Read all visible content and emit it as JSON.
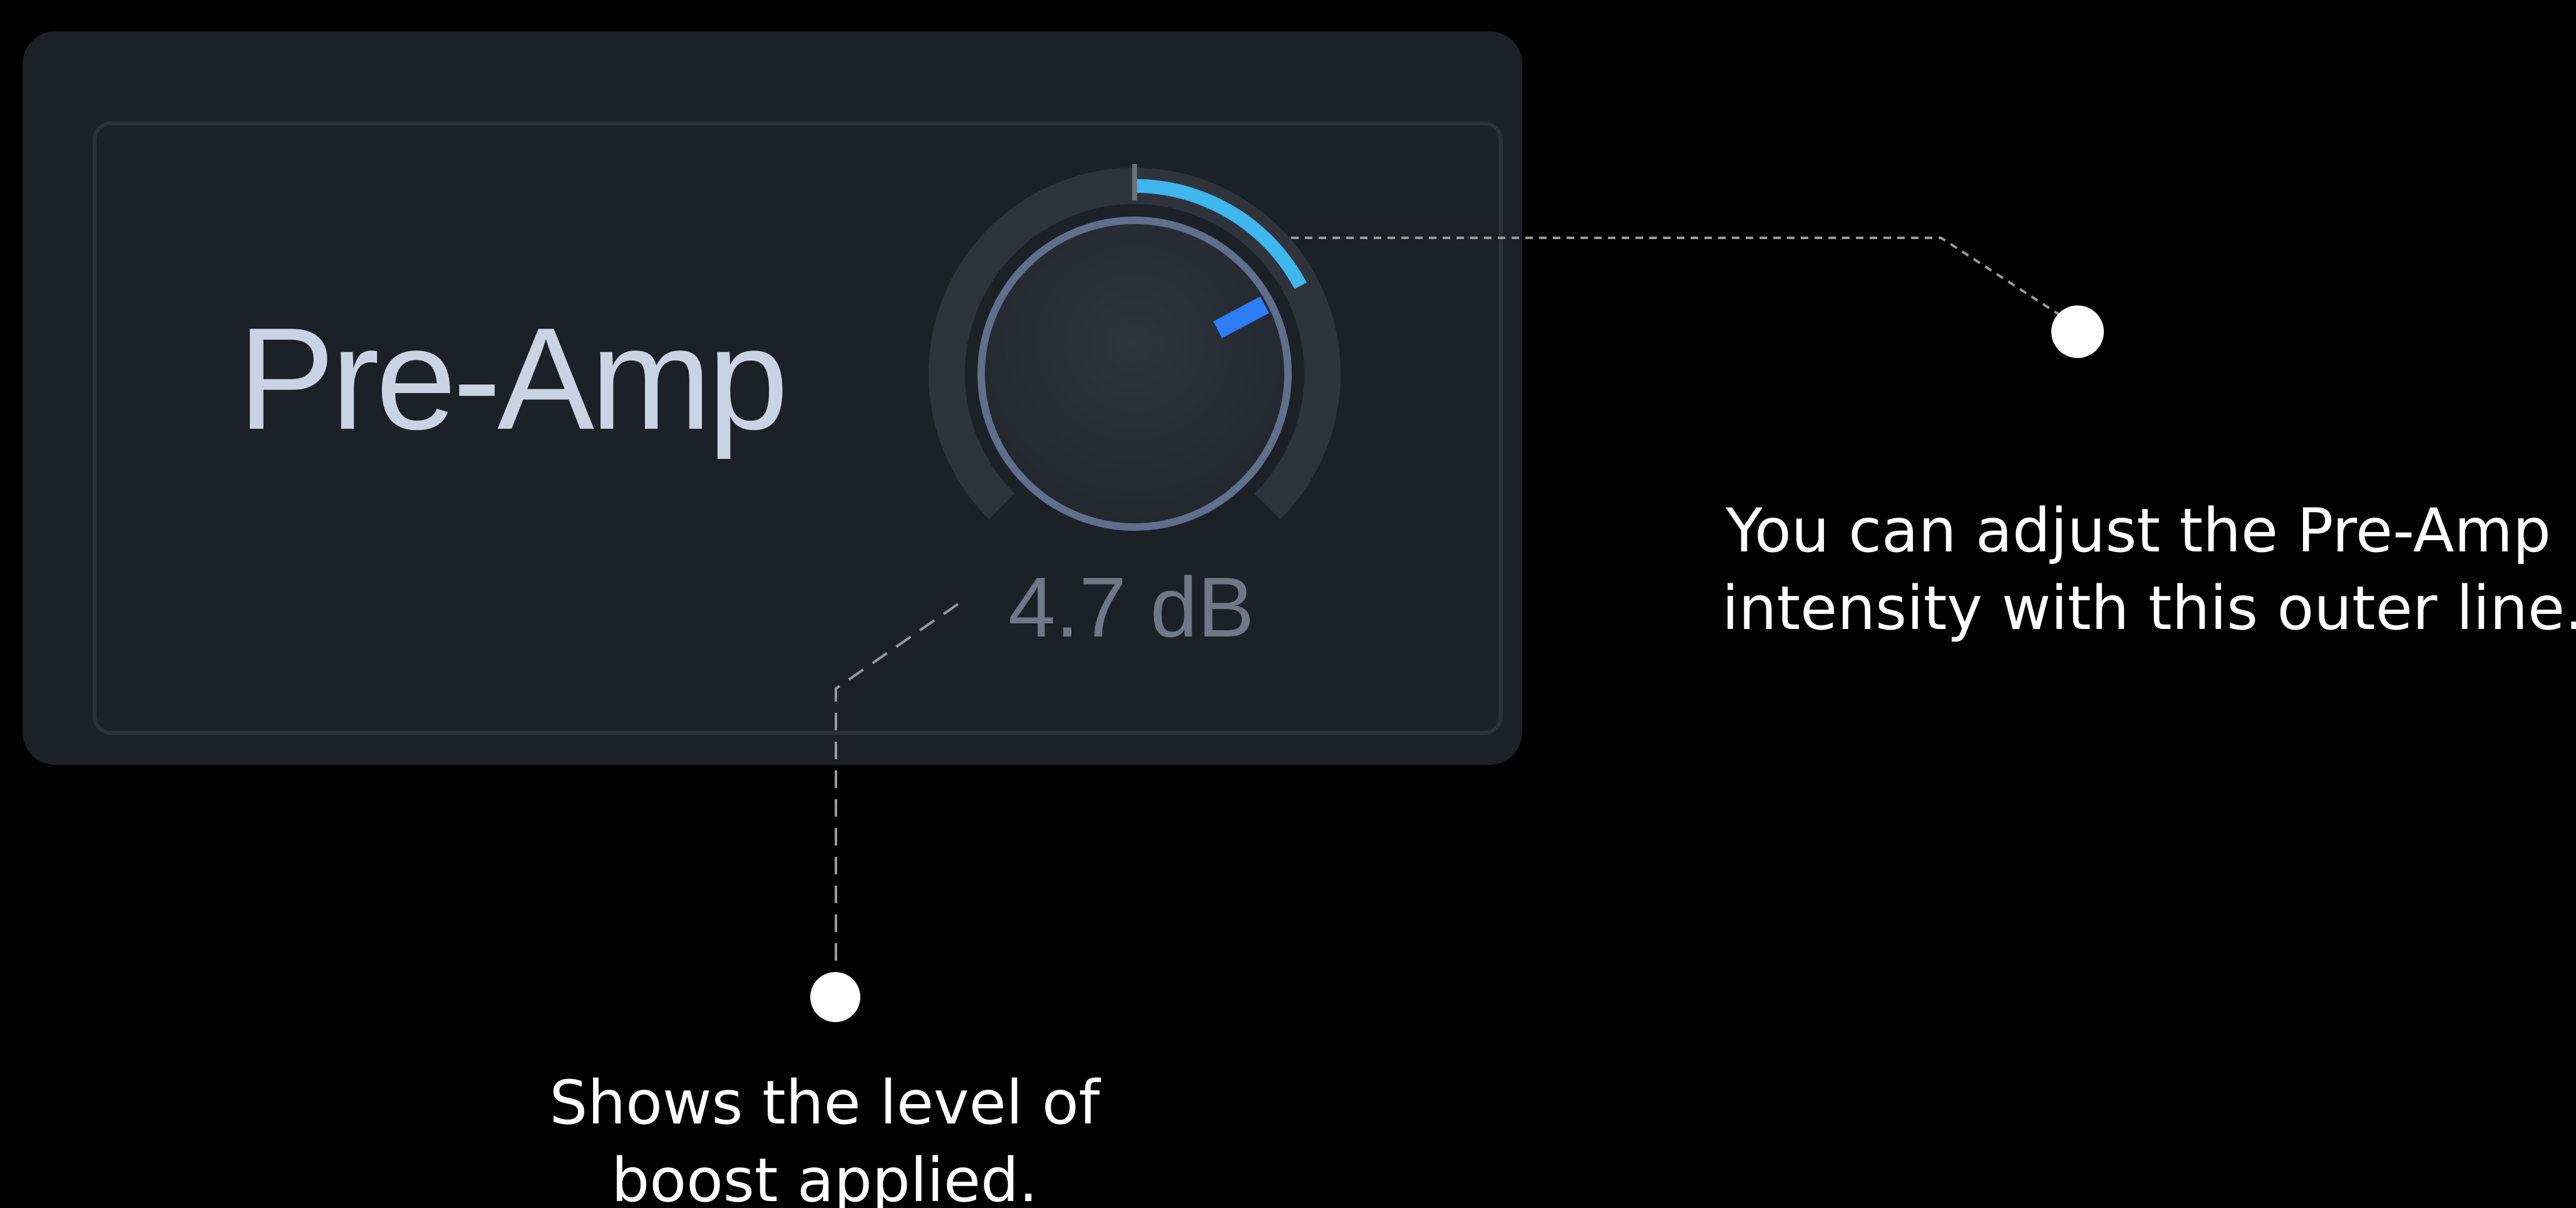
{
  "preamp": {
    "title": "Pre-Amp",
    "value_label": "4.7 dB",
    "intensity_fraction": 0.27,
    "arc_color": "#3fb6ee",
    "indicator_color": "#2d7df6"
  },
  "callouts": {
    "outer_line": {
      "line1": "You can adjust the Pre-Amp",
      "line2": "intensity with this outer line."
    },
    "level": {
      "line1": "Shows the level of",
      "line2": "boost applied."
    }
  }
}
